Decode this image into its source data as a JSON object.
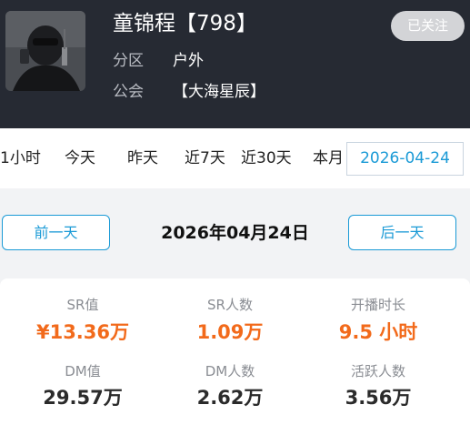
{
  "profile": {
    "name": "童锦程【798】",
    "category_label": "分区",
    "category_value": "户外",
    "guild_label": "公会",
    "guild_value": "【大海星辰】",
    "follow_button": "已关注"
  },
  "tabs": [
    {
      "label": "1小时"
    },
    {
      "label": "今天"
    },
    {
      "label": "昨天"
    },
    {
      "label": "近7天"
    },
    {
      "label": "近30天"
    },
    {
      "label": "本月"
    }
  ],
  "date_picker": {
    "value": "2026-04-24"
  },
  "day_nav": {
    "prev_label": "前一天",
    "current_date": "2026年04月24日",
    "next_label": "后一天"
  },
  "stats": [
    {
      "label": "SR值",
      "value": "¥13.36万"
    },
    {
      "label": "SR人数",
      "value": "1.09万"
    },
    {
      "label": "开播时长",
      "value": "9.5 小时"
    },
    {
      "label": "DM值",
      "value": "29.57万"
    },
    {
      "label": "DM人数",
      "value": "2.62万"
    },
    {
      "label": "活跃人数",
      "value": "3.56万"
    }
  ],
  "colors": {
    "accent": "#1a9ad6",
    "highlight": "#f26a1b",
    "header_bg": "#262a33"
  }
}
